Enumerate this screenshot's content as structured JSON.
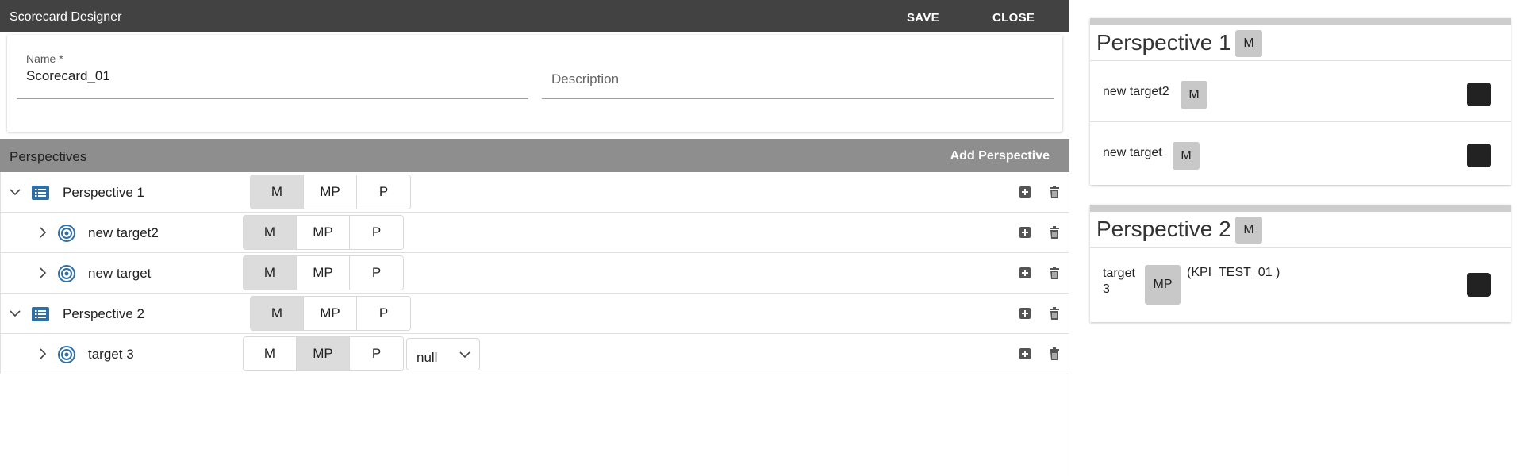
{
  "designer": {
    "title": "Scorecard Designer",
    "save_label": "SAVE",
    "close_label": "CLOSE",
    "form": {
      "name_label": "Name *",
      "name_value": "Scorecard_01",
      "description_placeholder": "Description"
    },
    "perspectives_title": "Perspectives",
    "add_perspective_label": "Add Perspective",
    "tree": {
      "p1": {
        "label": "Perspective 1",
        "options": [
          "M",
          "MP",
          "P"
        ],
        "selected": "M",
        "children": {
          "t1": {
            "label": "new target2",
            "options": [
              "M",
              "MP",
              "P"
            ],
            "selected": "M"
          },
          "t2": {
            "label": "new target",
            "options": [
              "M",
              "MP",
              "P"
            ],
            "selected": "M"
          }
        }
      },
      "p2": {
        "label": "Perspective 2",
        "options": [
          "M",
          "MP",
          "P"
        ],
        "selected": "M",
        "children": {
          "t3": {
            "label": "target 3",
            "options": [
              "M",
              "MP",
              "P"
            ],
            "selected": "MP",
            "dropdown_value": "null"
          }
        }
      }
    }
  },
  "preview": {
    "cards": {
      "c1": {
        "title": "Perspective 1",
        "badge": "M",
        "targets": {
          "a": {
            "name": "new target2",
            "badge": "M"
          },
          "b": {
            "name": "new target",
            "badge": "M"
          }
        }
      },
      "c2": {
        "title": "Perspective 2",
        "badge": "M",
        "targets": {
          "a": {
            "name_line1": "target",
            "name_line2": "3",
            "badge": "MP",
            "kpi": "(KPI_TEST_01 )"
          }
        }
      }
    }
  },
  "colors": {
    "topbar": "#424242",
    "perspectives_bar": "#8e8e8e",
    "icon_blue": "#2f6fa7",
    "selected_segment": "#dcdcdc",
    "badge": "#c8c8c8",
    "swatch": "#222222"
  },
  "icons": {
    "expand": "chevron-down-icon",
    "collapse": "chevron-right-icon",
    "perspective": "list-icon",
    "target": "target-icon",
    "add": "add-box-icon",
    "delete": "trash-icon"
  }
}
